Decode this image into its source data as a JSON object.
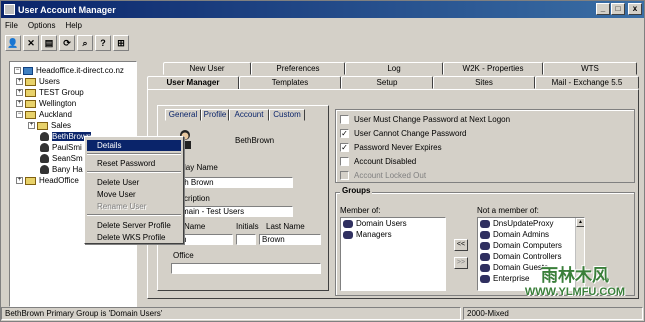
{
  "window": {
    "title": "User Account Manager",
    "buttons": [
      "_",
      "□",
      "x"
    ]
  },
  "menu": [
    "File",
    "Options",
    "Help"
  ],
  "toolbar": [
    "user-icon",
    "delete-icon",
    "copy-icon",
    "refresh-icon",
    "find-icon",
    "help-icon",
    "network-icon"
  ],
  "tree": {
    "root": "Headoffice.it-direct.co.nz",
    "nodes": [
      "Users",
      "TEST Group",
      "Wellington",
      "Auckland",
      "Sales",
      "BethBrown",
      "PaulSmi",
      "SeanSm",
      "Bany Ha",
      "HeadOffice"
    ]
  },
  "context_menu": {
    "items": [
      "Details",
      "Reset Password",
      "Delete User",
      "Move User",
      "Rename User",
      "Delete Server Profile",
      "Delete WKS Profile"
    ],
    "highlighted": "Details",
    "disabled": [
      "Rename User"
    ]
  },
  "tabs": {
    "row1": [
      "New User",
      "Preferences",
      "Log",
      "W2K - Properties",
      "WTS"
    ],
    "row2": [
      "User Manager",
      "Templates",
      "Setup",
      "Sites",
      "Mail - Exchange 5.5"
    ],
    "active": "User Manager"
  },
  "inner_tabs": [
    "General",
    "Profile",
    "Account",
    "Custom"
  ],
  "user": {
    "username": "BethBrown",
    "display_name_label": "lay Name",
    "display_name": "th Brown",
    "description_label": "cription",
    "description": "main - Test Users",
    "first_name_label": "Name",
    "first_name": "h",
    "initials_label": "Initials",
    "initials": "",
    "last_name_label": "Last Name",
    "last_name": "Brown",
    "office_label": "Office",
    "office": ""
  },
  "options": [
    {
      "label": "User Must Change Password at Next Logon",
      "checked": false,
      "disabled": false
    },
    {
      "label": "User Cannot Change Password",
      "checked": true,
      "disabled": false
    },
    {
      "label": "Password Never Expires",
      "checked": true,
      "disabled": false
    },
    {
      "label": "Account Disabled",
      "checked": false,
      "disabled": false
    },
    {
      "label": "Account Locked Out",
      "checked": false,
      "disabled": true
    }
  ],
  "groups": {
    "title": "Groups",
    "member_label": "Member of:",
    "member": [
      "Domain Users",
      "Managers"
    ],
    "not_member_label": "Not a member of:",
    "not_member": [
      "DnsUpdateProxy",
      "Domain Admins",
      "Domain Computers",
      "Domain Controllers",
      "Domain Guests",
      "Enterprise"
    ],
    "add_btn": "<<",
    "remove_btn": ">>"
  },
  "status": {
    "left": "BethBrown Primary Group is 'Domain Users'",
    "right": "2000-Mixed"
  },
  "watermark": {
    "line1": "雨林木风",
    "line2": "WWW.YLMFU.COM"
  }
}
